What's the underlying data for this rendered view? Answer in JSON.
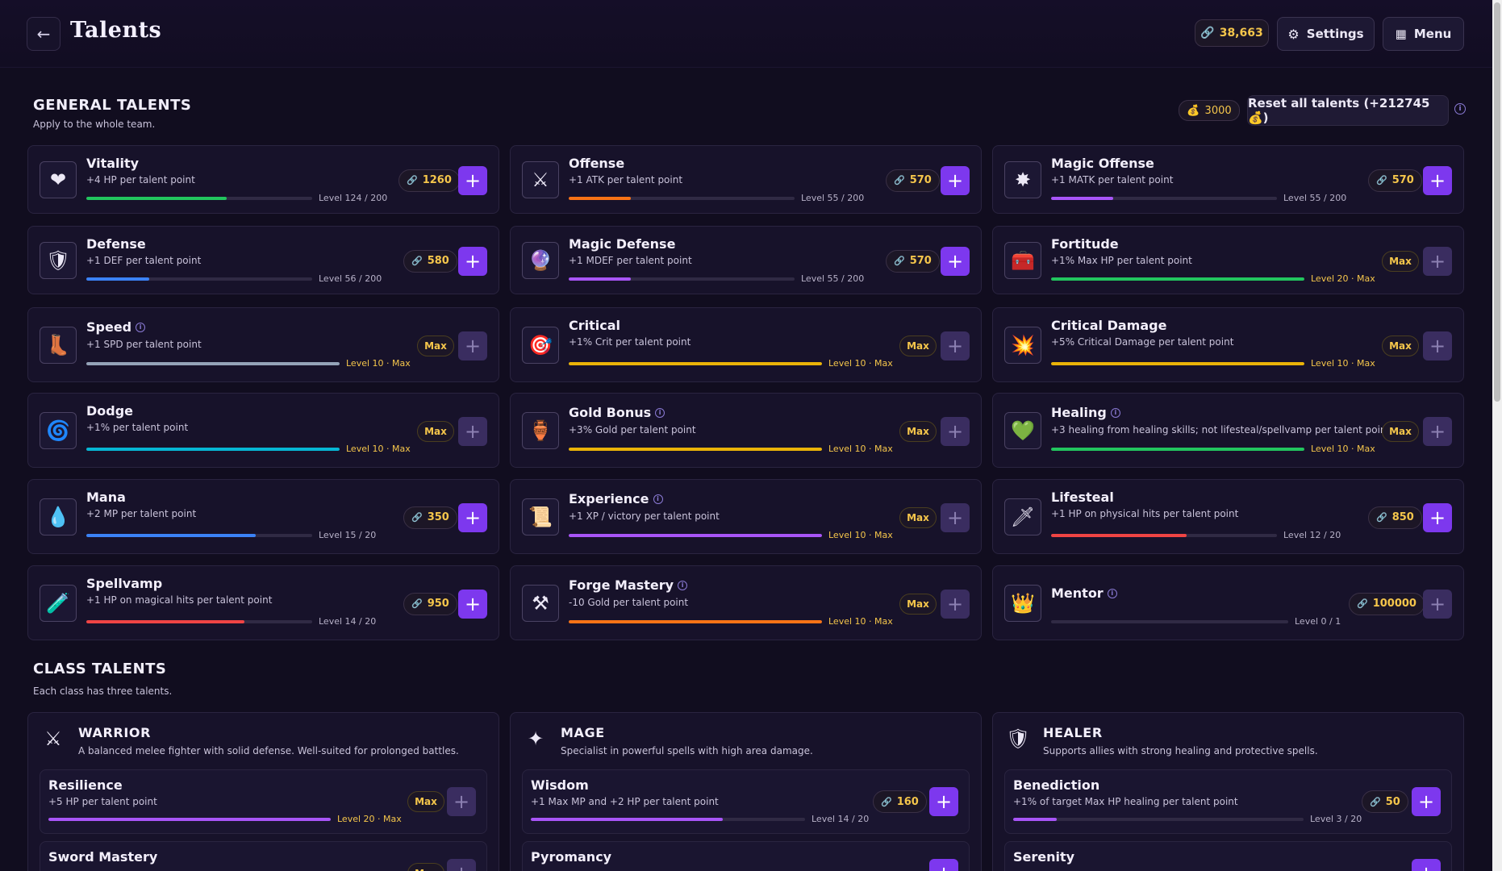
{
  "header": {
    "title": "Talents",
    "gold": "38,663",
    "settings_label": "Settings",
    "menu_label": "Menu"
  },
  "general": {
    "title": "GENERAL TALENTS",
    "subtitle": "Apply to the whole team.",
    "reset_cost": "3000",
    "reset_label": "Reset all talents (+212745 💰)",
    "talents": [
      {
        "name": "Vitality",
        "desc": "+4 HP per talent point",
        "level": "Level 124 / 200",
        "progress": 0.62,
        "cost": "1260",
        "maxed": false,
        "icon": "heart-icon"
      },
      {
        "name": "Offense",
        "desc": "+1 ATK per talent point",
        "level": "Level 55 / 200",
        "progress": 0.275,
        "cost": "570",
        "maxed": false,
        "icon": "crossed-swords-icon"
      },
      {
        "name": "Magic Offense",
        "desc": "+1 MATK per talent point",
        "level": "Level 55 / 200",
        "progress": 0.275,
        "cost": "570",
        "maxed": false,
        "icon": "magic-burst-icon"
      },
      {
        "name": "Defense",
        "desc": "+1 DEF per talent point",
        "level": "Level 56 / 200",
        "progress": 0.28,
        "cost": "580",
        "maxed": false,
        "icon": "shield-icon"
      },
      {
        "name": "Magic Defense",
        "desc": "+1 MDEF per talent point",
        "level": "Level 55 / 200",
        "progress": 0.275,
        "cost": "570",
        "maxed": false,
        "icon": "crystal-orb-icon"
      },
      {
        "name": "Fortitude",
        "desc": "+1% Max HP per talent point",
        "level": "Level 20 · Max",
        "progress": 1,
        "cost": "Max",
        "maxed": true,
        "icon": "chest-icon"
      },
      {
        "name": "Speed",
        "desc": "+1 SPD per talent point",
        "level": "Level 10 · Max",
        "progress": 1,
        "cost": "Max",
        "maxed": true,
        "icon": "boot-icon",
        "info": true
      },
      {
        "name": "Critical",
        "desc": "+1% Crit per talent point",
        "level": "Level 10 · Max",
        "progress": 1,
        "cost": "Max",
        "maxed": true,
        "icon": "target-icon"
      },
      {
        "name": "Critical Damage",
        "desc": "+5% Critical Damage per talent point",
        "level": "Level 10 · Max",
        "progress": 1,
        "cost": "Max",
        "maxed": true,
        "icon": "explosion-icon"
      },
      {
        "name": "Dodge",
        "desc": "+1% per talent point",
        "level": "Level 10 · Max",
        "progress": 1,
        "cost": "Max",
        "maxed": true,
        "icon": "swirl-icon"
      },
      {
        "name": "Gold Bonus",
        "desc": "+3% Gold per talent point",
        "level": "Level 10 · Max",
        "progress": 1,
        "cost": "Max",
        "maxed": true,
        "icon": "gold-pot-icon",
        "info": true
      },
      {
        "name": "Healing",
        "desc": "+3 healing from healing skills; not lifesteal/spellvamp per talent point",
        "level": "Level 10 · Max",
        "progress": 1,
        "cost": "Max",
        "maxed": true,
        "icon": "green-heart-icon",
        "info": true
      },
      {
        "name": "Mana",
        "desc": "+2 MP per talent point",
        "level": "Level 15 / 20",
        "progress": 0.75,
        "cost": "350",
        "maxed": false,
        "icon": "water-drop-icon"
      },
      {
        "name": "Experience",
        "desc": "+1 XP / victory per talent point",
        "level": "Level 10 · Max",
        "progress": 1,
        "cost": "Max",
        "maxed": true,
        "icon": "scroll-icon",
        "info": true
      },
      {
        "name": "Lifesteal",
        "desc": "+1 HP on physical hits per talent point",
        "level": "Level 12 / 20",
        "progress": 0.6,
        "cost": "850",
        "maxed": false,
        "icon": "blood-dagger-icon"
      },
      {
        "name": "Spellvamp",
        "desc": "+1 HP on magical hits per talent point",
        "level": "Level 14 / 20",
        "progress": 0.7,
        "cost": "950",
        "maxed": false,
        "icon": "potion-icon"
      },
      {
        "name": "Forge Mastery",
        "desc": "-10 Gold per talent point",
        "level": "Level 10 · Max",
        "progress": 1,
        "cost": "Max",
        "maxed": true,
        "icon": "anvil-icon",
        "info": true
      },
      {
        "name": "Mentor",
        "desc": "",
        "level": "Level 0 / 1",
        "progress": 0,
        "cost": "100000",
        "maxed": false,
        "icon": "crown-icon",
        "info": true,
        "disabled": true
      }
    ]
  },
  "classes": {
    "title": "CLASS TALENTS",
    "subtitle": "Each class has three talents.",
    "items": [
      {
        "name": "WARRIOR",
        "desc": "A balanced melee fighter with solid defense. Well-suited for prolonged battles.",
        "icon": "warrior-crest-icon",
        "talents": [
          {
            "name": "Resilience",
            "desc": "+5 HP per talent point",
            "level": "Level 20 · Max",
            "progress": 1,
            "cost": "Max",
            "maxed": true
          },
          {
            "name": "Sword Mastery",
            "desc": "",
            "level": "",
            "progress": 0,
            "cost": "Max",
            "maxed": true
          }
        ]
      },
      {
        "name": "MAGE",
        "desc": "Specialist in powerful spells with high area damage.",
        "icon": "mage-crest-icon",
        "talents": [
          {
            "name": "Wisdom",
            "desc": "+1 Max MP and +2 HP per talent point",
            "level": "Level 14 / 20",
            "progress": 0.7,
            "cost": "160",
            "maxed": false
          },
          {
            "name": "Pyromancy",
            "desc": "",
            "level": "",
            "progress": 0,
            "cost": "",
            "maxed": false
          }
        ]
      },
      {
        "name": "HEALER",
        "desc": "Supports allies with strong healing and protective spells.",
        "icon": "healer-crest-icon",
        "talents": [
          {
            "name": "Benediction",
            "desc": "+1% of target Max HP healing per talent point",
            "level": "Level 3 / 20",
            "progress": 0.15,
            "cost": "50",
            "maxed": false
          },
          {
            "name": "Serenity",
            "desc": "",
            "level": "",
            "progress": 0,
            "cost": "",
            "maxed": false
          }
        ]
      }
    ]
  },
  "colors": {
    "accent": "#7d38ee",
    "gold": "#f5c64b",
    "bar_green": "#22c55e",
    "bar_orange": "#f97316",
    "bar_purple": "#a855f7",
    "bar_blue": "#3b82f6",
    "bar_gray": "#94a3b8",
    "bar_yellow": "#eab308",
    "bar_cyan": "#06b6d4",
    "bar_red": "#ef4444"
  }
}
